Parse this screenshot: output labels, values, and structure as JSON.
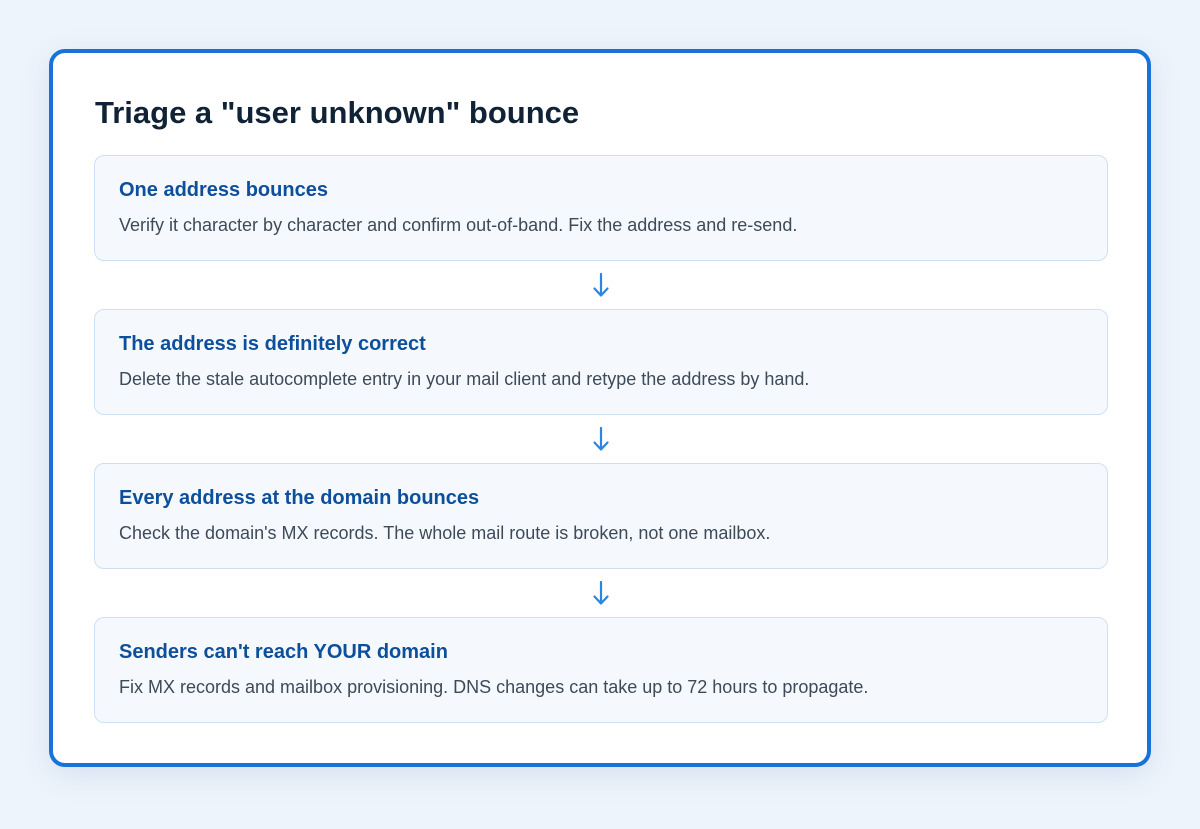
{
  "title": "Triage a \"user unknown\" bounce",
  "colors": {
    "accent": "#1a72d8",
    "step_title": "#0d4f9b",
    "arrow": "#2a86e0"
  },
  "steps": [
    {
      "title": "One address bounces",
      "description": "Verify it character by character and confirm out-of-band. Fix the address and re-send."
    },
    {
      "title": "The address is definitely correct",
      "description": "Delete the stale autocomplete entry in your mail client and retype the address by hand."
    },
    {
      "title": "Every address at the domain bounces",
      "description": "Check the domain's MX records. The whole mail route is broken, not one mailbox."
    },
    {
      "title": "Senders can't reach YOUR domain",
      "description": "Fix MX records and mailbox provisioning. DNS changes can take up to 72 hours to propagate."
    }
  ],
  "arrow_icon": "arrow-down-icon"
}
